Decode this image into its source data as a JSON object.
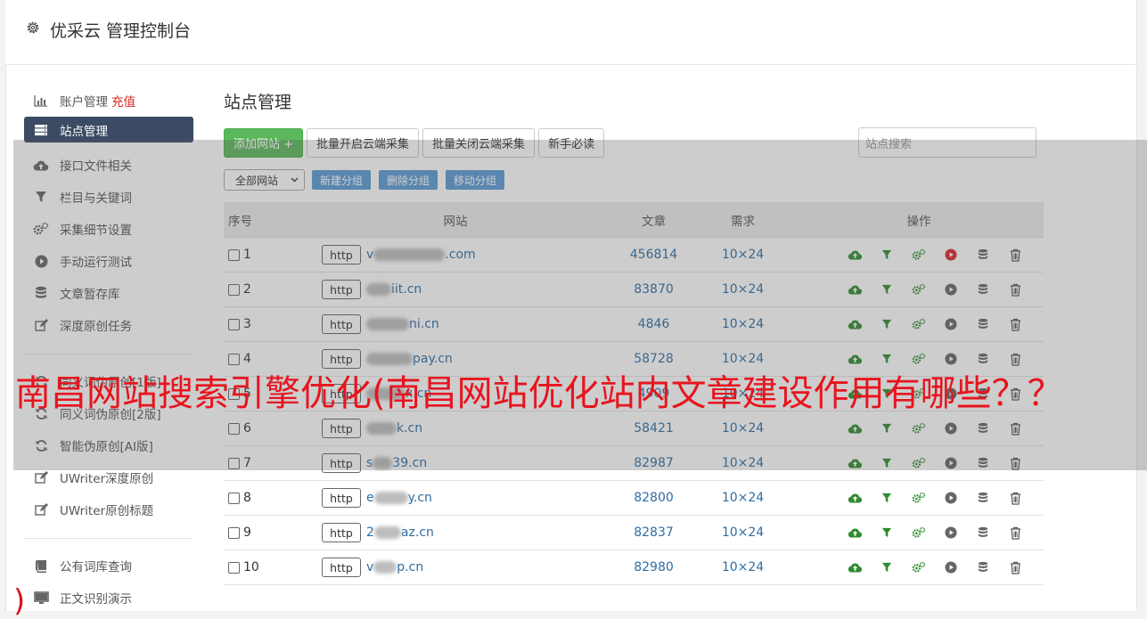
{
  "header": {
    "title": "优采云 管理控制台",
    "icon": "gear-icon"
  },
  "sidebar": {
    "items": [
      {
        "label": "账户管理",
        "extra": "充值",
        "icon": "bar-chart-icon"
      },
      {
        "label": "站点管理",
        "icon": "server-icon",
        "active": true
      },
      {
        "label": "接口文件相关",
        "icon": "cloud-upload-icon"
      },
      {
        "label": "栏目与关键词",
        "icon": "filter-icon"
      },
      {
        "label": "采集细节设置",
        "icon": "gears-icon"
      },
      {
        "label": "手动运行测试",
        "icon": "play-circle-icon"
      },
      {
        "label": "文章暂存库",
        "icon": "database-icon"
      },
      {
        "label": "深度原创任务",
        "icon": "edit-icon"
      }
    ],
    "items2": [
      {
        "label": "同义词伪原创[1版]",
        "icon": "refresh-icon"
      },
      {
        "label": "同义词伪原创[2版]",
        "icon": "refresh-icon"
      },
      {
        "label": "智能伪原创[AI版]",
        "icon": "refresh-icon"
      },
      {
        "label": "UWriter深度原创",
        "icon": "edit-icon"
      },
      {
        "label": "UWriter原创标题",
        "icon": "edit-icon"
      }
    ],
    "items3": [
      {
        "label": "公有词库查询",
        "icon": "book-icon"
      },
      {
        "label": "正文识别演示",
        "icon": "monitor-icon"
      }
    ]
  },
  "main": {
    "title": "站点管理",
    "toolbar": {
      "add_site": "添加网站 +",
      "batch_open": "批量开启云端采集",
      "batch_close": "批量关闭云端采集",
      "beginner": "新手必读",
      "search_placeholder": "站点搜索"
    },
    "toolbar2": {
      "group_select": "全部网站",
      "new_group": "新建分组",
      "delete_group": "删除分组",
      "move_group": "移动分组"
    },
    "table": {
      "headers": {
        "no": "序号",
        "site": "网站",
        "articles": "文章",
        "demand": "需求",
        "ops": "操作"
      },
      "rows": [
        {
          "no": "1",
          "prefix": "http",
          "domain_start": "v",
          "domain_end": ".com",
          "articles": "456814",
          "demand": "10×24",
          "running": true
        },
        {
          "no": "2",
          "prefix": "http",
          "domain_start": "",
          "domain_end": "iit.cn",
          "articles": "83870",
          "demand": "10×24",
          "running": false
        },
        {
          "no": "3",
          "prefix": "http",
          "domain_start": "",
          "domain_end": "ni.cn",
          "articles": "4846",
          "demand": "10×24",
          "running": false
        },
        {
          "no": "4",
          "prefix": "http",
          "domain_start": "",
          "domain_end": "pay.cn",
          "articles": "58728",
          "demand": "10×24",
          "running": false
        },
        {
          "no": "5",
          "prefix": "http",
          "domain_start": "",
          "domain_end": "x.cn",
          "articles": "4909",
          "demand": "10×24",
          "running": false
        },
        {
          "no": "6",
          "prefix": "http",
          "domain_start": "",
          "domain_end": "k.cn",
          "articles": "58421",
          "demand": "10×24",
          "running": false
        },
        {
          "no": "7",
          "prefix": "http",
          "domain_start": "s",
          "domain_end": "39.cn",
          "articles": "82987",
          "demand": "10×24",
          "running": false
        },
        {
          "no": "8",
          "prefix": "http",
          "domain_start": "e",
          "domain_end": "y.cn",
          "articles": "82800",
          "demand": "10×24",
          "running": false
        },
        {
          "no": "9",
          "prefix": "http",
          "domain_start": "2",
          "domain_end": "az.cn",
          "articles": "82837",
          "demand": "10×24",
          "running": false
        },
        {
          "no": "10",
          "prefix": "http",
          "domain_start": "v",
          "domain_end": "p.cn",
          "articles": "82980",
          "demand": "10×24",
          "running": false
        }
      ]
    }
  },
  "overlay": {
    "banner": "南昌网站搜索引擎优化(南昌网站优化站内文章建设作用有哪些？？",
    "paren": ")"
  },
  "colors": {
    "green": "#2e8b2e",
    "red_play": "#e0242a",
    "nav_active": "#3c4a63",
    "link": "#2e6da4",
    "banner": "#e8141e"
  }
}
